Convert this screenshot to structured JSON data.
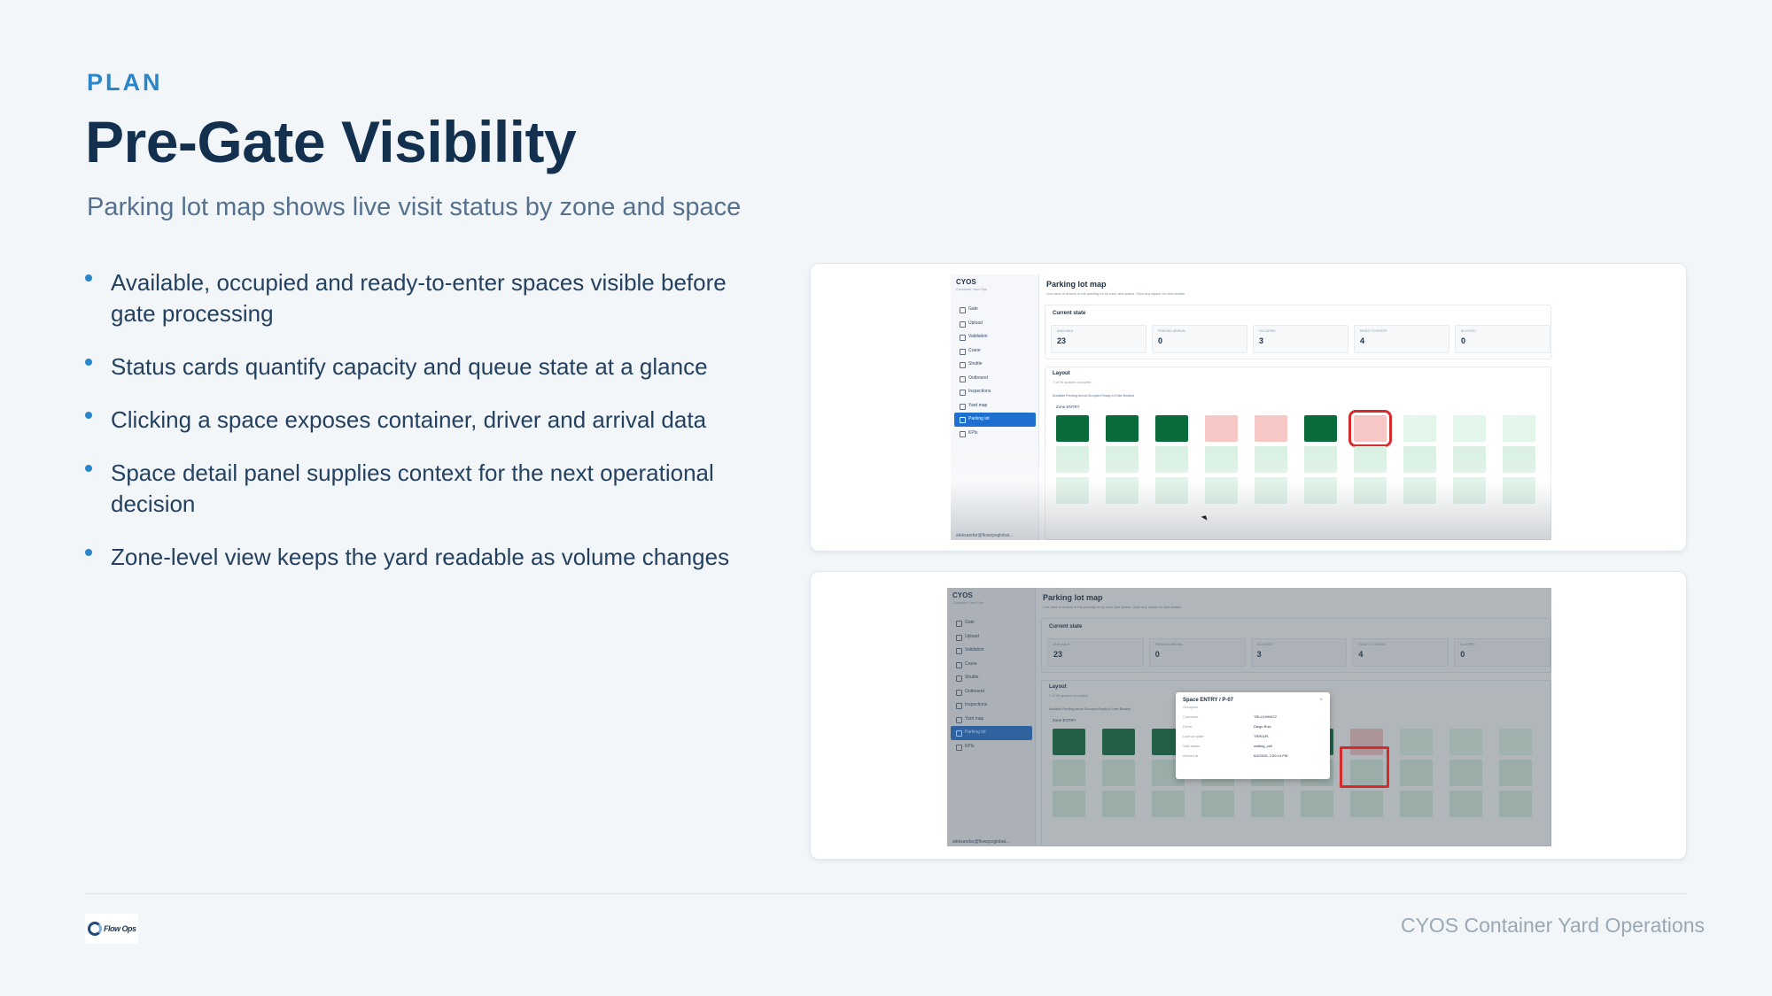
{
  "eyebrow": "PLAN",
  "title": "Pre-Gate Visibility",
  "subtitle": "Parking lot map shows live visit status by zone and space",
  "bullets": [
    "Available, occupied and ready-to-enter spaces visible before gate processing",
    "Status cards quantify capacity and queue state at a glance",
    "Clicking a space exposes container, driver and arrival data",
    "Space detail panel supplies context for the next operational decision",
    "Zone-level view keeps the yard readable as volume changes"
  ],
  "footer": {
    "logo_text": "Flow Ops",
    "caption": "CYOS Container Yard Operations"
  },
  "app": {
    "brand": "CYOS",
    "brand_sub": "Container Yard Ops",
    "nav": [
      "Gate",
      "Upload",
      "Validation",
      "Crane",
      "Shuttle",
      "Outbound",
      "Inspections",
      "Yard map",
      "Parking lot",
      "KPIs"
    ],
    "active_nav": "Parking lot",
    "user": "aleksandar@flowopsglobal...",
    "page_title": "Parking lot map",
    "page_desc": "Live view of drivers in the parking lot by zone and space. Click any space for visit details.",
    "current_state_title": "Current state",
    "stats": [
      {
        "label": "AVAILABLE",
        "value": "23"
      },
      {
        "label": "PENDING ARRIVAL",
        "value": "0"
      },
      {
        "label": "OCCUPIED",
        "value": "3"
      },
      {
        "label": "READY TO ENTER",
        "value": "4"
      },
      {
        "label": "BLOCKED",
        "value": "0"
      }
    ],
    "layout_title": "Layout",
    "layout_sub": "7 of 30 spaces occupied",
    "legend": "Available  Pending Arrival  Occupied  Ready to Enter  Blocked",
    "zone": "Zone ENTRY",
    "popup": {
      "title": "Space ENTRY / P-07",
      "status": "Occupied",
      "close": "×",
      "rows": [
        {
          "k": "Container",
          "v": "TRLU1999872"
        },
        {
          "k": "Driver",
          "v": "Diego Ruiz"
        },
        {
          "k": "License plate",
          "v": "TRR01PL"
        },
        {
          "k": "Visit status",
          "v": "waiting_call"
        },
        {
          "k": "Arrived at",
          "v": "6/4/2026, 2:59:14 PM"
        }
      ]
    }
  }
}
